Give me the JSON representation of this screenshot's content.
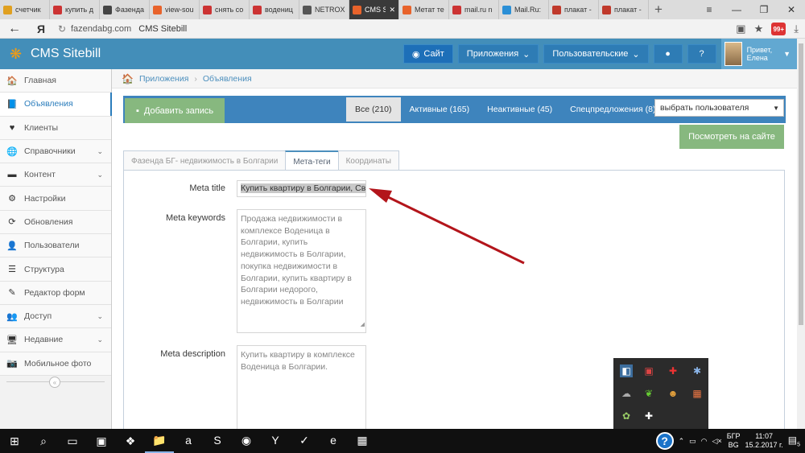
{
  "browser": {
    "tabs": [
      {
        "title": "счетчик",
        "icon": "bars-chart-icon",
        "color": "#e0a020"
      },
      {
        "title": "купить д",
        "icon": "yandex-icon",
        "color": "#cc3333"
      },
      {
        "title": "Фазенда",
        "icon": "home-icon",
        "color": "#444444"
      },
      {
        "title": "view-sou",
        "icon": "sitebill-icon",
        "color": "#e8632b"
      },
      {
        "title": "снять со",
        "icon": "yandex-icon",
        "color": "#cc3333"
      },
      {
        "title": "водениц",
        "icon": "yandex-icon",
        "color": "#cc3333"
      },
      {
        "title": "NETROX",
        "icon": "diamond-icon",
        "color": "#555555"
      },
      {
        "title": "CMS S",
        "icon": "sitebill-icon",
        "color": "#e8632b",
        "active": true
      },
      {
        "title": "Метат те",
        "icon": "sitebill-icon",
        "color": "#e8632b"
      },
      {
        "title": "mail.ru n",
        "icon": "yandex-icon",
        "color": "#cc3333"
      },
      {
        "title": "Mail.Ru:",
        "icon": "globe-icon",
        "color": "#2b8fd6"
      },
      {
        "title": "плакат -",
        "icon": "gmail-icon",
        "color": "#c0392b"
      },
      {
        "title": "плакат -",
        "icon": "gmail-icon",
        "color": "#c0392b"
      }
    ],
    "address": {
      "host": "fazendabg.com",
      "page_title": "CMS Sitebill"
    },
    "ext_badge": "99+"
  },
  "header": {
    "brand": "CMS Sitebill",
    "site_button": "Сайт",
    "apps_button": "Приложения",
    "custom_button": "Пользовательские",
    "greeting": "Привет,",
    "user_name": "Елена"
  },
  "sidebar": {
    "items": [
      {
        "label": "Главная",
        "icon": "home-icon",
        "glyph": "🏠"
      },
      {
        "label": "Объявления",
        "icon": "book-icon",
        "glyph": "📘",
        "active": true
      },
      {
        "label": "Клиенты",
        "icon": "heart-icon",
        "glyph": "♥"
      },
      {
        "label": "Справочники",
        "icon": "globe-icon",
        "glyph": "🌐",
        "chevron": true
      },
      {
        "label": "Контент",
        "icon": "desktop-icon",
        "glyph": "▬",
        "chevron": true
      },
      {
        "label": "Настройки",
        "icon": "gear-icon",
        "glyph": "⚙"
      },
      {
        "label": "Обновления",
        "icon": "refresh-icon",
        "glyph": "⟳"
      },
      {
        "label": "Пользователи",
        "icon": "user-icon",
        "glyph": "👤"
      },
      {
        "label": "Структура",
        "icon": "list-icon",
        "glyph": "☰"
      },
      {
        "label": "Редактор форм",
        "icon": "edit-icon",
        "glyph": "✎"
      },
      {
        "label": "Доступ",
        "icon": "users-icon",
        "glyph": "👥",
        "chevron": true
      },
      {
        "label": "Недавние",
        "icon": "monitor-icon",
        "glyph": "🖥",
        "chevron": true
      },
      {
        "label": "Мобильное фото",
        "icon": "camera-icon",
        "glyph": "📷"
      }
    ]
  },
  "breadcrumb": {
    "level1": "Приложения",
    "level2": "Объявления"
  },
  "toolbar": {
    "add_label": "Добавить запись",
    "filters": [
      {
        "label": "Все (210)",
        "active": true
      },
      {
        "label": "Активные (165)"
      },
      {
        "label": "Неактивные (45)"
      },
      {
        "label": "Спецпредложения (8)"
      }
    ],
    "user_select": "выбрать пользователя",
    "view_site": "Посмотреть на сайте"
  },
  "form": {
    "tabs": [
      {
        "label": "Фазенда БГ- недвижимость в Болгарии"
      },
      {
        "label": "Мета-теги",
        "active": true
      },
      {
        "label": "Координаты"
      }
    ],
    "meta_title_label": "Meta title",
    "meta_title_value": "Купить квартиру в Болгарии, Св",
    "meta_keywords_label": "Meta keywords",
    "meta_keywords_value": "Продажа недвижимости в комплексе Воденица в Болгарии, купить недвижимость в Болгарии, покупка недвижимости в Болгарии, купить квартиру в Болгарии недорого, недвижимость в Болгарии",
    "meta_description_label": "Meta description",
    "meta_description_value": "Купить  квартиру в комплексе Воденица в Болгарии."
  },
  "colors": {
    "header": "#438eb9",
    "accent": "#2b7dbc",
    "green": "#87b87f",
    "arrow": "#b3151b"
  },
  "taskbar": {
    "apps": [
      {
        "name": "file-explorer-icon",
        "glyph": "📁",
        "open": true
      },
      {
        "name": "amazon-icon",
        "glyph": "a"
      },
      {
        "name": "skype-icon",
        "glyph": "S"
      },
      {
        "name": "chrome-icon",
        "glyph": "◉"
      },
      {
        "name": "yandex-browser-icon",
        "glyph": "Y"
      },
      {
        "name": "sticky-app-icon",
        "glyph": "✓"
      },
      {
        "name": "edge-icon",
        "glyph": "e"
      },
      {
        "name": "winrar-icon",
        "glyph": "▦"
      }
    ],
    "lang_top": "БГР",
    "lang_bottom": "BG",
    "time": "11:07",
    "date": "15.2.2017 г.",
    "notifications": "5"
  }
}
